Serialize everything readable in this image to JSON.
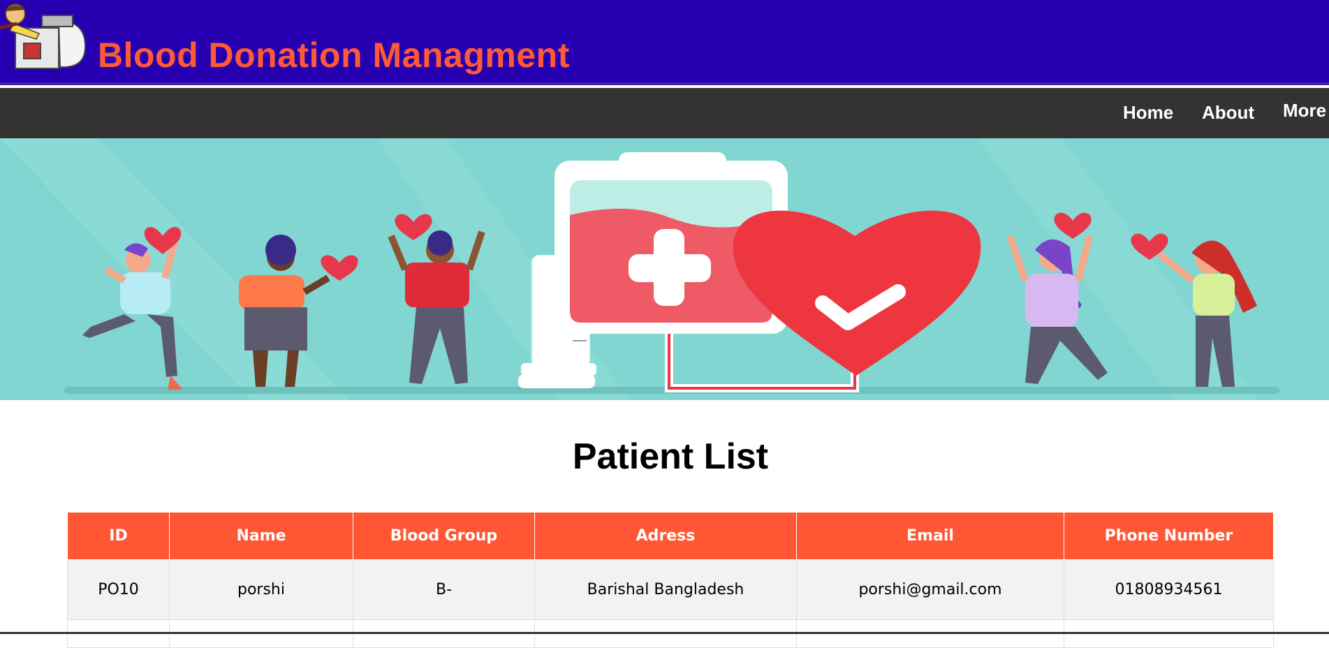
{
  "header": {
    "title": "Blood Donation Managment"
  },
  "nav": {
    "home": "Home",
    "about": "About",
    "more": "More"
  },
  "main": {
    "title": "Patient List"
  },
  "table": {
    "columns": [
      "ID",
      "Name",
      "Blood Group",
      "Adress",
      "Email",
      "Phone Number"
    ],
    "rows": [
      [
        "PO10",
        "porshi",
        "B-",
        "Barishal Bangladesh",
        "porshi@gmail.com",
        "01808934561"
      ]
    ]
  },
  "colors": {
    "header_bg": "#2600b0",
    "title": "#ff5a38",
    "nav_bg": "#333333",
    "table_header": "#ff5733",
    "banner_bg": "#82d6d2"
  }
}
